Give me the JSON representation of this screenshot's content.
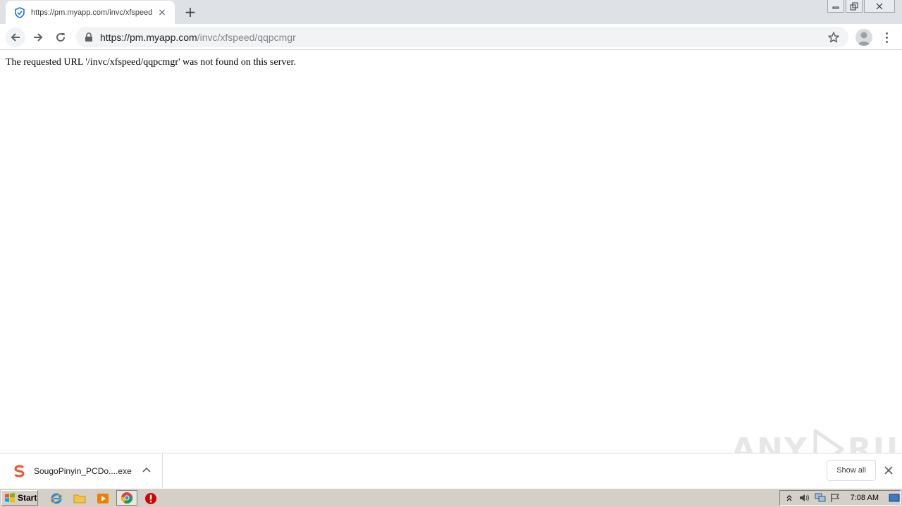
{
  "tab": {
    "title": "https://pm.myapp.com/invc/xfspeed/qqpcmgr",
    "favicon": "shield-icon",
    "close": "×"
  },
  "new_tab": "+",
  "address_bar": {
    "host": "https://pm.myapp.com",
    "path": "/invc/xfspeed/qqpcmgr"
  },
  "page": {
    "message": "The requested URL '/invc/xfspeed/qqpcmgr' was not found on this server."
  },
  "watermark": {
    "left": "ANY",
    "right": "RUN"
  },
  "download_shelf": {
    "file_name": "SougoPinyin_PCDo....exe",
    "show_all": "Show all"
  },
  "taskbar": {
    "start_label": "Start",
    "clock": "7:08 AM"
  },
  "colors": {
    "tab_strip": "#dee1e6",
    "omnibox": "#f1f3f4",
    "url_path": "#80868b",
    "taskbar": "#d4d0c8"
  }
}
